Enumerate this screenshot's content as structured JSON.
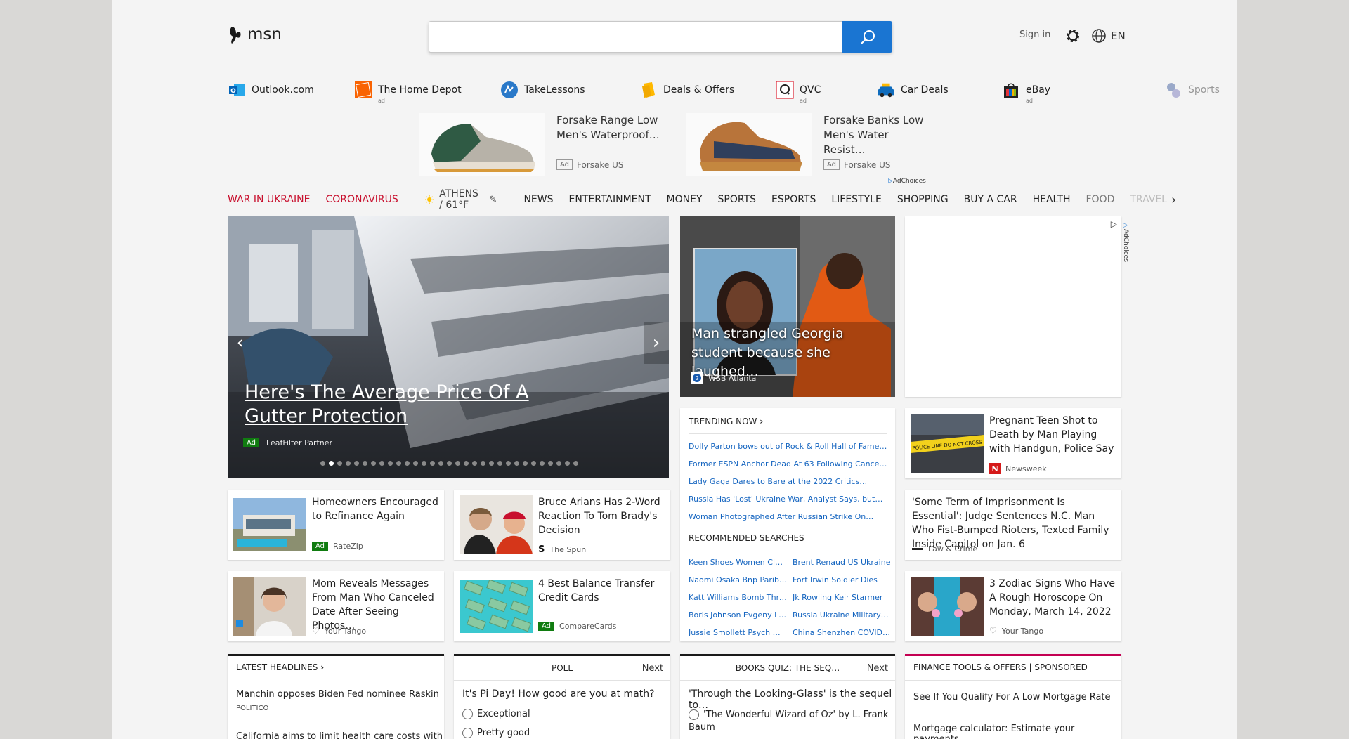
{
  "header": {
    "logo_text": "msn",
    "search_placeholder": "",
    "signin": "Sign in",
    "language": "EN"
  },
  "quick_links": [
    {
      "label": "Outlook.com",
      "ad": ""
    },
    {
      "label": "The Home Depot",
      "ad": "ad"
    },
    {
      "label": "TakeLessons",
      "ad": ""
    },
    {
      "label": "Deals & Offers",
      "ad": ""
    },
    {
      "label": "QVC",
      "ad": "ad"
    },
    {
      "label": "Car Deals",
      "ad": ""
    },
    {
      "label": "eBay",
      "ad": "ad"
    },
    {
      "label": "Sports",
      "ad": ""
    }
  ],
  "ads": [
    {
      "title": "Forsake Range Low Men's Waterproof…",
      "tag": "Ad",
      "source": "Forsake US"
    },
    {
      "title": "Forsake Banks Low Men's Water Resist…",
      "tag": "Ad",
      "source": "Forsake US"
    }
  ],
  "adchoices": "AdChoices",
  "nav": {
    "war": "WAR IN UKRAINE",
    "corona": "CORONAVIRUS",
    "weather": "ATHENS / 61°F",
    "items": [
      "NEWS",
      "ENTERTAINMENT",
      "MONEY",
      "SPORTS",
      "ESPORTS",
      "LIFESTYLE",
      "SHOPPING",
      "BUY A CAR",
      "HEALTH",
      "FOOD",
      "TRAVEL"
    ]
  },
  "hero": {
    "title": "Here's The Average Price Of A Gutter Protection",
    "tag": "Ad",
    "source": "LeafFilter Partner"
  },
  "story": {
    "title": "Man strangled Georgia student because she laughed…",
    "source": "WSB Atlanta"
  },
  "trending": {
    "heading": "TRENDING NOW",
    "links": [
      "Dolly Parton bows out of Rock & Roll Hall of Fame…",
      "Former ESPN Anchor Dead At 63 Following Cancer…",
      "Lady Gaga Dares to Bare at the 2022 Critics…",
      "Russia Has 'Lost' Ukraine War, Analyst Says, but…",
      "Woman Photographed After Russian Strike On…"
    ],
    "rec_heading": "RECOMMENDED SEARCHES",
    "rec": [
      [
        "Keen Shoes Women Clea…",
        "Brent Renaud US Ukraine"
      ],
      [
        "Naomi Osaka Bnp Pariba…",
        "Fort Irwin Soldier Dies"
      ],
      [
        "Katt Williams Bomb Threat",
        "Jk Rowling Keir Starmer"
      ],
      [
        "Boris Johnson Evgeny Le…",
        "Russia Ukraine Military …"
      ],
      [
        "Jussie Smollett Psych Wa…",
        "China Shenzhen COVID…"
      ]
    ]
  },
  "cards": {
    "teen": {
      "title": "Pregnant Teen Shot to Death by Man Playing with Handgun, Police Say",
      "source": "Newsweek"
    },
    "judge": {
      "title": "'Some Term of Imprisonment Is Essential': Judge Sentences N.C. Man Who Fist-Bumped Rioters, Texted Family Inside Capitol on Jan. 6",
      "source": "Law & Crime"
    },
    "zodiac": {
      "title": "3 Zodiac Signs Who Have A Rough Horoscope On Monday, March 14, 2022",
      "source": "Your Tango"
    },
    "refi": {
      "title": "Homeowners Encouraged to Refinance Again",
      "tag": "Ad",
      "source": "RateZip"
    },
    "arians": {
      "title": "Bruce Arians Has 2-Word Reaction To Tom Brady's Decision",
      "source": "The Spun"
    },
    "mom": {
      "title": "Mom Reveals Messages From Man Who Canceled Date After Seeing Photos…",
      "source": "Your Tango"
    },
    "balance": {
      "title": "4 Best Balance Transfer Credit Cards",
      "tag": "Ad",
      "source": "CompareCards"
    }
  },
  "widgets": {
    "headlines": {
      "heading": "LATEST HEADLINES",
      "items": [
        {
          "text": "Manchin opposes Biden Fed nominee Raskin",
          "src": "POLITICO"
        },
        {
          "text": "California aims to limit health care costs with"
        }
      ]
    },
    "poll": {
      "heading": "POLL",
      "next": "Next",
      "question": "It's Pi Day! How good are you at math?",
      "options": [
        "Exceptional",
        "Pretty good"
      ]
    },
    "quiz": {
      "heading": "BOOKS QUIZ: THE SEQ…",
      "next": "Next",
      "question": "'Through the Looking-Glass' is the sequel to…",
      "option": "'The Wonderful Wizard of Oz' by L. Frank Baum"
    },
    "finance": {
      "heading": "FINANCE TOOLS & OFFERS | SPONSORED",
      "items": [
        "See If You Qualify For A Low Mortgage Rate",
        "Mortgage calculator: Estimate your payments"
      ]
    }
  },
  "colors": {
    "accent": "#1a75d2",
    "nav_red": "#c8102e",
    "finance_border": "#c30052",
    "ad_green": "#107c10"
  }
}
